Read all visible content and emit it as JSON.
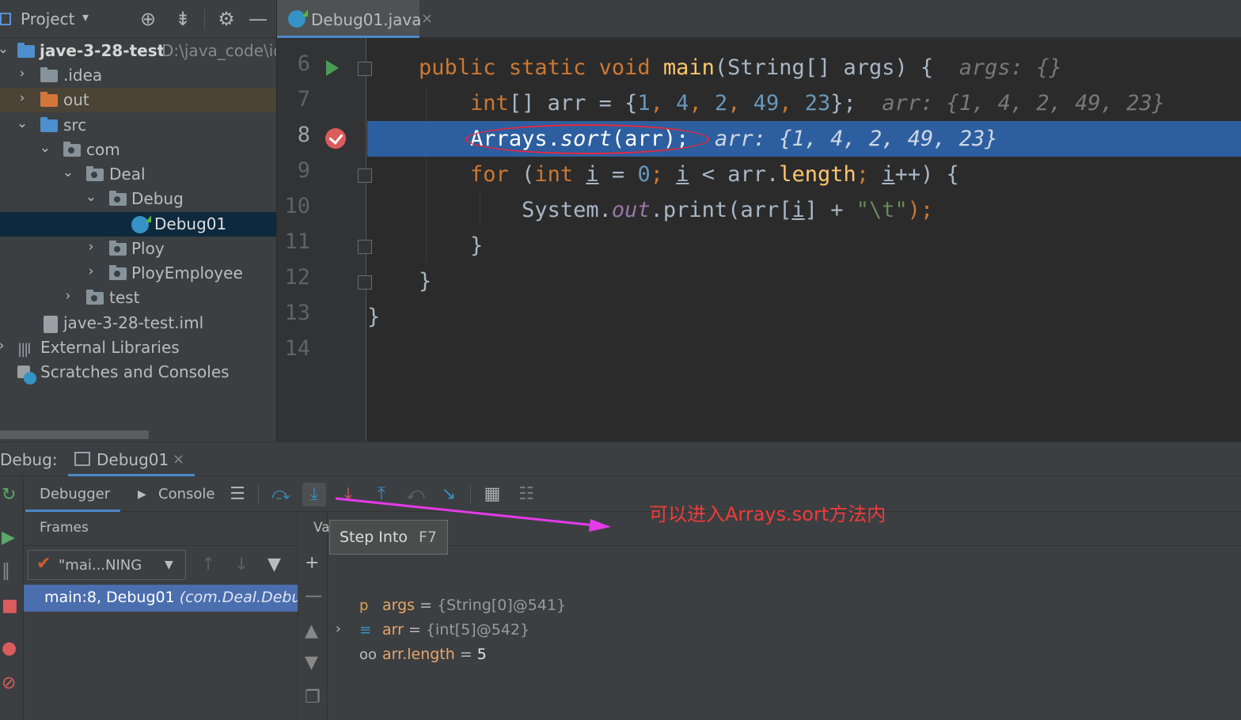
{
  "project_panel": {
    "title": "Project",
    "dropdown_glyph": "▾",
    "icons": [
      "target-icon",
      "collapse-icon",
      "gear-icon",
      "minimize-icon"
    ],
    "tree": [
      {
        "label": "jave-3-28-test",
        "path": "D:\\java_code\\id",
        "kind": "module",
        "expanded": true
      },
      {
        "label": ".idea",
        "kind": "folder",
        "expanded": false
      },
      {
        "label": "out",
        "kind": "folder-orange",
        "expanded": false
      },
      {
        "label": "src",
        "kind": "folder-blue",
        "expanded": true
      },
      {
        "label": "com",
        "kind": "package",
        "expanded": true
      },
      {
        "label": "Deal",
        "kind": "package",
        "expanded": true
      },
      {
        "label": "Debug",
        "kind": "package",
        "expanded": true
      },
      {
        "label": "Debug01",
        "kind": "class",
        "selected": true
      },
      {
        "label": "Ploy",
        "kind": "package",
        "expanded": false
      },
      {
        "label": "PloyEmployee",
        "kind": "package",
        "expanded": false
      },
      {
        "label": "test",
        "kind": "package",
        "expanded": false
      },
      {
        "label": "jave-3-28-test.iml",
        "kind": "iml"
      },
      {
        "label": "External Libraries",
        "kind": "libraries"
      },
      {
        "label": "Scratches and Consoles",
        "kind": "scratches"
      }
    ]
  },
  "editor": {
    "tab_label": "Debug01.java",
    "tab_close": "×",
    "line_numbers": [
      "6",
      "7",
      "8",
      "9",
      "10",
      "11",
      "12",
      "13",
      "14"
    ],
    "current_line": "8",
    "code": {
      "l6_kw": "public static void ",
      "l6_fn": "main",
      "l6_a": "(String[] args) {",
      "l6_hint": "args: {}",
      "l7_kw": "int",
      "l7_a": "[] arr = {",
      "l7_n1": "1",
      "l7_n2": "4",
      "l7_n3": "2",
      "l7_n4": "49",
      "l7_n5": "23",
      "l7_b": "};",
      "l7_hint": "arr: {1, 4, 2, 49, 23}",
      "l8_a": "Arrays.",
      "l8_m": "sort",
      "l8_b": "(arr);",
      "l8_hint": "arr: {1, 4, 2, 49, 23}",
      "l9_kw": "for",
      "l9_a": " (",
      "l9_kw2": "int",
      "l9_b": " ",
      "l9_i1": "i",
      "l9_c": " = ",
      "l9_n": "0",
      "l9_d": "; ",
      "l9_i2": "i",
      "l9_e": " < arr.",
      "l9_f": "length",
      "l9_g": "; ",
      "l9_i3": "i",
      "l9_h": "++) {",
      "l10_a": "System.",
      "l10_out": "out",
      "l10_b": ".print(arr[",
      "l10_i": "i",
      "l10_c": "] + ",
      "l10_str": "\"\\t\"",
      "l10_d": ");",
      "l11": "}",
      "l12": "}",
      "l13": "}"
    }
  },
  "debug": {
    "title": "Debug:",
    "session_tab": "Debug01",
    "session_close": "×",
    "tabs": {
      "debugger": "Debugger",
      "console": "Console"
    },
    "toolbar_icons": [
      "menu-icon",
      "step-over-icon",
      "step-into-icon",
      "force-step-into-icon",
      "step-out-icon",
      "drop-frame-icon",
      "run-to-cursor-icon",
      "evaluate-icon",
      "trace-icon"
    ],
    "frames_header": "Frames",
    "thread": "\"mai...NING",
    "frame": {
      "name": "main:8, Debug01",
      "pkg": "(com.Deal.Debu"
    },
    "variables_header": "Va",
    "variables": [
      {
        "name": "args",
        "eq": " = ",
        "value": "{String[0]@541}",
        "icon": "p"
      },
      {
        "name": "arr",
        "eq": " = ",
        "value": "{int[5]@542}",
        "icon": "≡"
      },
      {
        "name": "arr.length",
        "eq": " = ",
        "value": "5",
        "icon": "oo"
      }
    ],
    "tooltip": {
      "label": "Step Into",
      "shortcut": "F7"
    }
  },
  "annotation": {
    "text": "可以进入Arrays.sort方法内",
    "color": "#f23a3a",
    "arrow_color": "#e43ae8"
  },
  "colors": {
    "keyword": "#cc7832",
    "function": "#ffc66d",
    "number": "#6897bb",
    "execution_line": "#2d5fa0",
    "breakpoint": "#db5c5c"
  }
}
